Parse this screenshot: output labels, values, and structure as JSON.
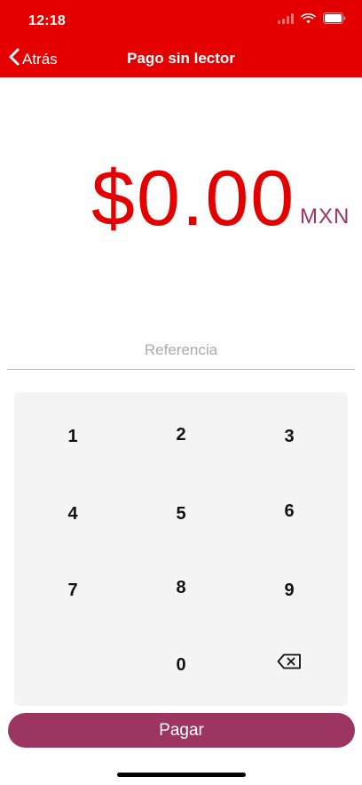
{
  "status_bar": {
    "time": "12:18"
  },
  "nav": {
    "back_label": "Atrás",
    "title": "Pago sin lector"
  },
  "amount": {
    "value": "$0.00",
    "currency": "MXN"
  },
  "reference": {
    "placeholder": "Referencia",
    "value": ""
  },
  "keypad": {
    "keys": {
      "k1": "1",
      "k2": "2",
      "k3": "3",
      "k4": "4",
      "k5": "5",
      "k6": "6",
      "k7": "7",
      "k8": "8",
      "k9": "9",
      "k0": "0"
    },
    "backspace_icon": "backspace-icon"
  },
  "pay_button": {
    "label": "Pagar"
  },
  "colors": {
    "header_red": "#e50000",
    "amount_red": "#e50000",
    "accent_plum": "#9c3562",
    "keypad_bg": "#f4f4f4"
  }
}
